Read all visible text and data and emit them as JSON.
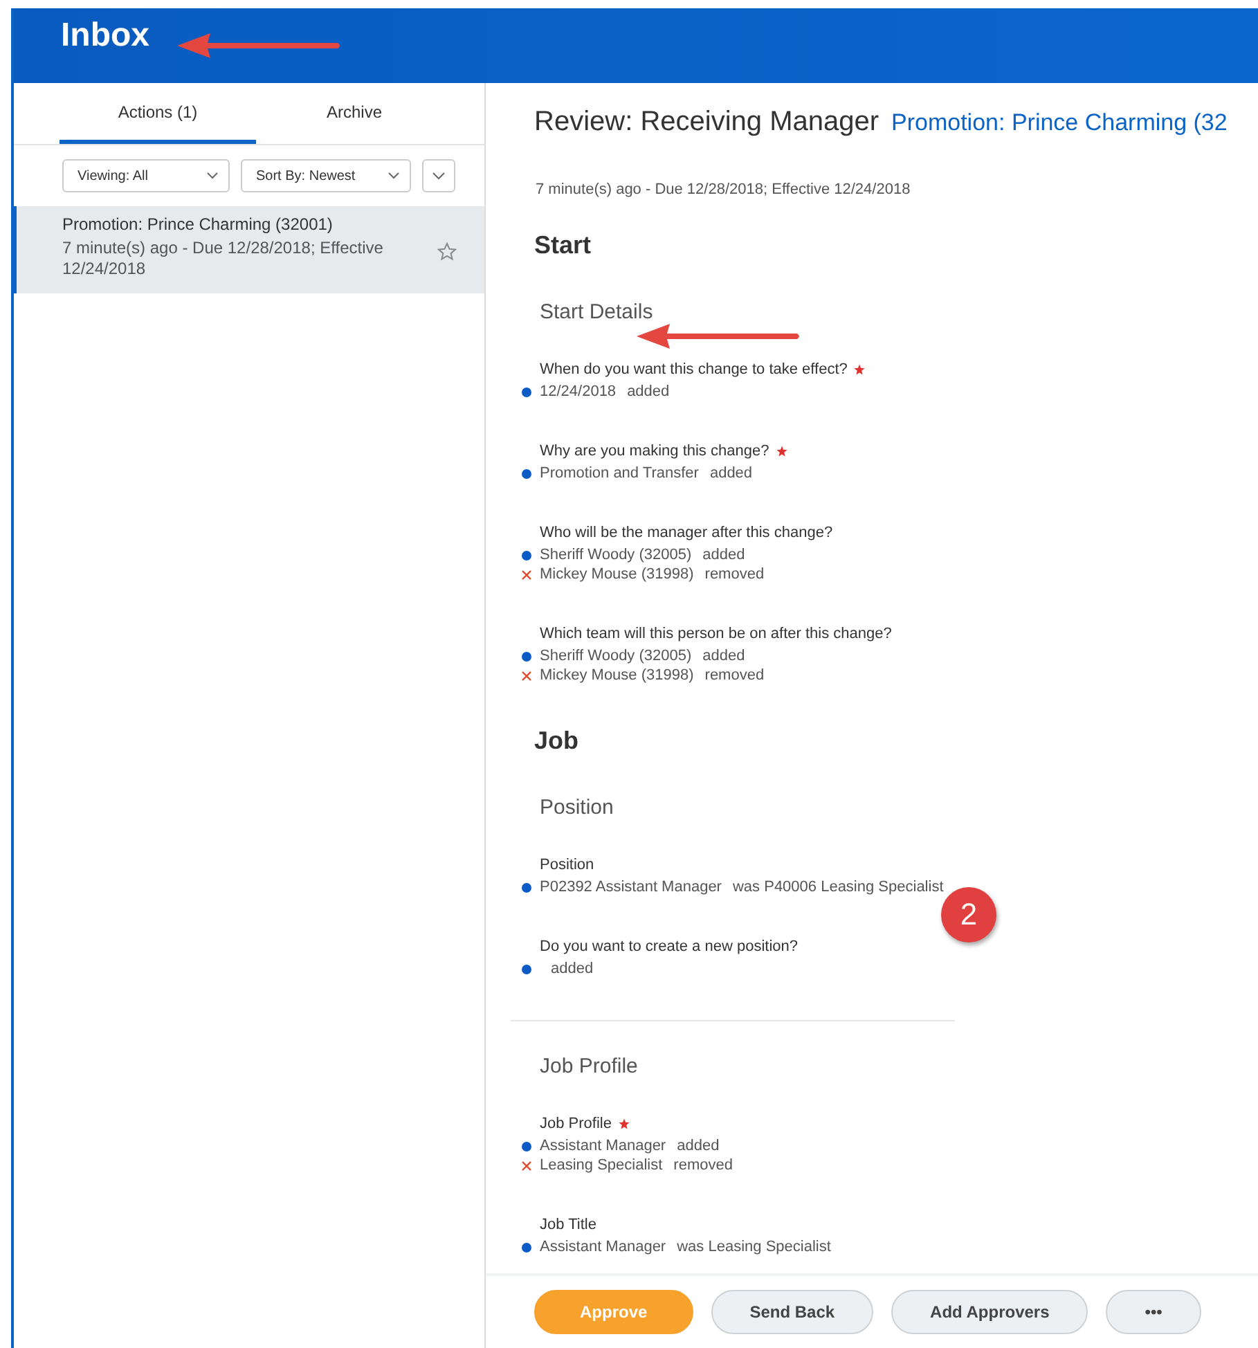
{
  "header": {
    "title": "Inbox"
  },
  "sidebar": {
    "tabs": [
      {
        "label": "Actions (1)",
        "selected": true
      },
      {
        "label": "Archive",
        "selected": false
      }
    ],
    "filters": [
      {
        "label": "Viewing:",
        "value": "All"
      },
      {
        "label": "Sort By:",
        "value": "Newest"
      }
    ],
    "items": [
      {
        "title": "Promotion: Prince Charming (32001)",
        "subtitle": "7 minute(s) ago - Due 12/28/2018; Effective 12/24/2018",
        "selected": true
      }
    ]
  },
  "review": {
    "title": "Review: Receiving Manager",
    "link": "Promotion: Prince Charming (32",
    "meta": "7 minute(s) ago - Due 12/28/2018; Effective 12/24/2018",
    "sections": [
      {
        "title": "Start",
        "subsections": [
          {
            "title": "Start Details",
            "fields": [
              {
                "question": "When do you want this change to take effect?",
                "required": true,
                "changes": [
                  {
                    "kind": "added",
                    "value": "12/24/2018",
                    "note": "added"
                  }
                ]
              },
              {
                "question": "Why are you making this change?",
                "required": true,
                "changes": [
                  {
                    "kind": "added",
                    "value": "Promotion and Transfer",
                    "note": "added"
                  }
                ]
              },
              {
                "question": "Who will be the manager after this change?",
                "required": false,
                "changes": [
                  {
                    "kind": "added",
                    "value": "Sheriff Woody (32005)",
                    "note": "added"
                  },
                  {
                    "kind": "removed",
                    "value": "Mickey Mouse (31998)",
                    "note": "removed"
                  }
                ]
              },
              {
                "question": "Which team will this person be on after this change?",
                "required": false,
                "changes": [
                  {
                    "kind": "added",
                    "value": "Sheriff Woody (32005)",
                    "note": "added"
                  },
                  {
                    "kind": "removed",
                    "value": "Mickey Mouse (31998)",
                    "note": "removed"
                  }
                ]
              }
            ]
          }
        ]
      },
      {
        "title": "Job",
        "subsections": [
          {
            "title": "Position",
            "fields": [
              {
                "question": "Position",
                "required": false,
                "changes": [
                  {
                    "kind": "changed",
                    "value": "P02392 Assistant Manager",
                    "note": "was P40006 Leasing Specialist"
                  }
                ]
              },
              {
                "question": "Do you want to create a new position?",
                "required": false,
                "changes": [
                  {
                    "kind": "added",
                    "note": "added"
                  }
                ]
              }
            ]
          },
          {
            "title": "Job Profile",
            "fields": [
              {
                "question": "Job Profile",
                "required": true,
                "changes": [
                  {
                    "kind": "added",
                    "value": "Assistant Manager",
                    "note": "added"
                  },
                  {
                    "kind": "removed",
                    "value": "Leasing Specialist",
                    "note": "removed"
                  }
                ]
              },
              {
                "question": "Job Title",
                "required": false,
                "changes": [
                  {
                    "kind": "changed",
                    "value": "Assistant Manager",
                    "note": "was Leasing Specialist"
                  }
                ]
              }
            ]
          }
        ]
      }
    ]
  },
  "actions": [
    {
      "label": "Approve",
      "primary": true
    },
    {
      "label": "Send Back",
      "primary": false
    },
    {
      "label": "Add Approvers",
      "primary": false
    },
    {
      "label": "•••",
      "primary": false
    }
  ],
  "annotations": [
    {
      "kind": "arrow"
    },
    {
      "kind": "arrow"
    },
    {
      "kind": "badge",
      "label": "2"
    }
  ]
}
